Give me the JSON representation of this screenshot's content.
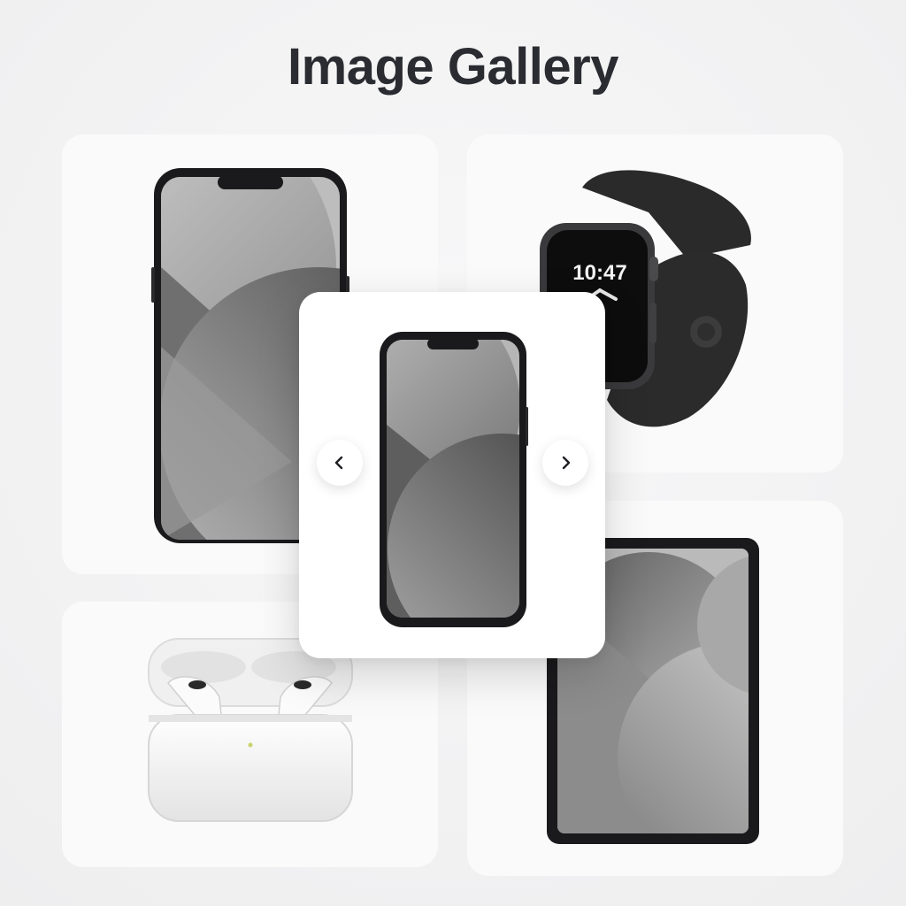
{
  "gallery": {
    "title": "Image Gallery"
  },
  "items": [
    {
      "name": "phone"
    },
    {
      "name": "watch",
      "time": "10:47"
    },
    {
      "name": "earbuds"
    },
    {
      "name": "tablet"
    }
  ],
  "lightbox": {
    "prev_icon": "chevron-left-icon",
    "next_icon": "chevron-right-icon"
  },
  "colors": {
    "title": "#2a2c31",
    "card_bg": "#fafafa",
    "page_bg": "#f3f3f4",
    "device_frame": "#1a1a1c"
  }
}
